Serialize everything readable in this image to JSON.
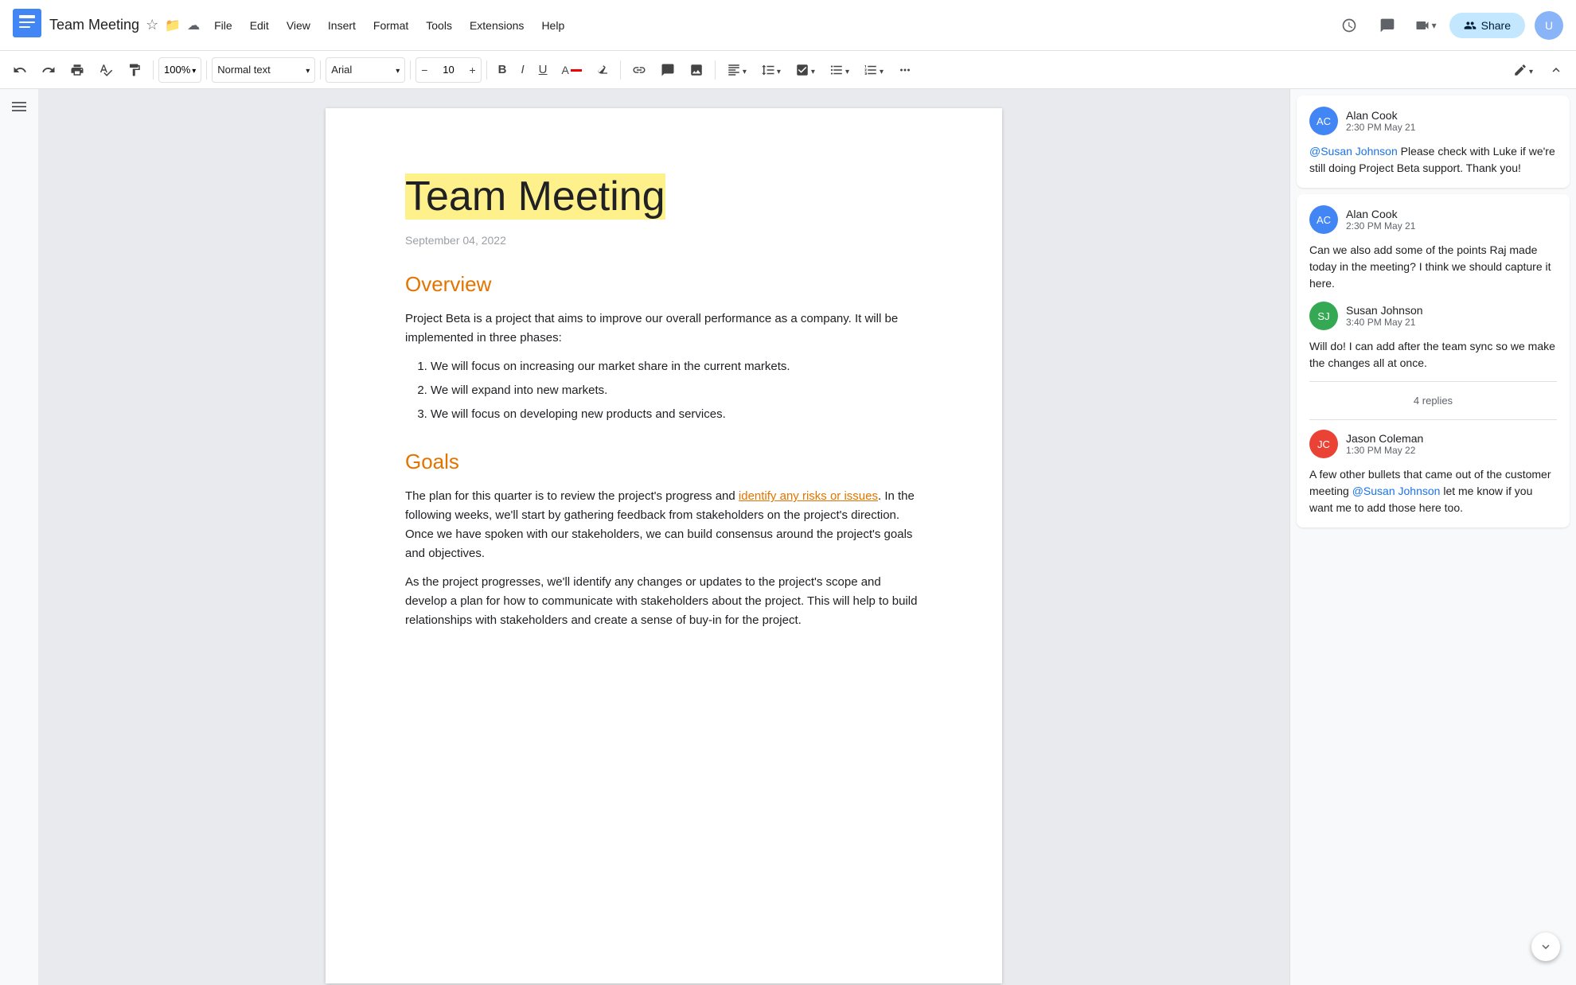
{
  "app": {
    "icon_color": "#4285f4",
    "title": "Team Meeting"
  },
  "title_icons": {
    "star": "☆",
    "folder": "⊡",
    "cloud": "☁"
  },
  "menu": {
    "items": [
      "File",
      "Edit",
      "View",
      "Insert",
      "Format",
      "Tools",
      "Extensions",
      "Help"
    ]
  },
  "toolbar": {
    "undo": "↩",
    "redo": "↪",
    "print": "🖨",
    "paint_format": "🖌",
    "zoom": "100%",
    "paragraph_style": "Normal text",
    "font": "Arial",
    "font_size": "10",
    "bold": "B",
    "italic": "I",
    "underline": "U",
    "more": "⋯"
  },
  "document": {
    "title": "Team Meeting",
    "date": "September 04, 2022",
    "overview_heading": "Overview",
    "overview_body": "Project Beta is a project that aims to improve our overall performance as a company. It will be implemented in three phases:",
    "bullets": [
      "We will focus on increasing our market share in the current markets.",
      "We will expand into new markets.",
      "We will focus on developing new products and services."
    ],
    "goals_heading": "Goals",
    "goals_body_1": "The plan for this quarter is to review the project's progress and ",
    "goals_highlight": "identify any risks or issues",
    "goals_body_1_end": ". In the following weeks, we'll start by gathering feedback from stakeholders on the project's direction. Once we have spoken with our stakeholders, we can build consensus around the project's goals and objectives.",
    "goals_body_2": "As the project progresses, we'll identify any changes or updates to the project's scope and develop a plan for how to communicate with stakeholders about the project. This will help to build relationships with stakeholders and create a sense of buy-in for the project."
  },
  "comments": [
    {
      "id": "c1",
      "author": "Alan Cook",
      "initials": "AC",
      "time": "2:30 PM May 21",
      "mention": "@Susan Johnson",
      "body": " Please check with Luke if we're still doing Project Beta support. Thank you!",
      "replies": []
    },
    {
      "id": "c2",
      "author": "Alan Cook",
      "initials": "AC",
      "time": "2:30 PM May 21",
      "body": "Can we also add some of the points Raj made today in the meeting? I think we should capture it here.",
      "replies": [
        {
          "author": "Susan Johnson",
          "initials": "SJ",
          "time": "3:40 PM May 21",
          "body": "Will do! I can add after the team sync so we make the changes all at once."
        }
      ],
      "replies_count": "4 replies",
      "extra_reply": {
        "author": "Jason Coleman",
        "initials": "JC",
        "time": "1:30 PM May 22",
        "body_start": "A few other bullets that came out of the customer meeting ",
        "mention": "@Susan Johnson",
        "body_end": " let me know if you want me to add those here too."
      }
    }
  ],
  "share": {
    "label": "Share",
    "icon": "👤"
  }
}
